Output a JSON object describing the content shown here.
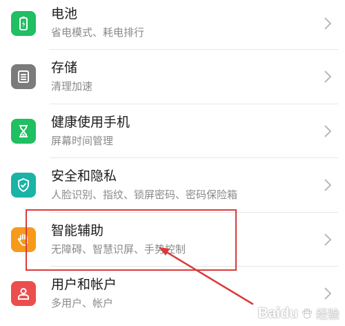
{
  "settings": {
    "items": [
      {
        "title": "电池",
        "subtitle": "省电模式、耗电排行",
        "icon": "battery-icon",
        "color": "#1fbf62"
      },
      {
        "title": "存储",
        "subtitle": "清理加速",
        "icon": "storage-icon",
        "color": "#7b7b7b"
      },
      {
        "title": "健康使用手机",
        "subtitle": "屏幕时间管理",
        "icon": "hourglass-icon",
        "color": "#1fbf62"
      },
      {
        "title": "安全和隐私",
        "subtitle": "人脸识别、指纹、锁屏密码、密码保险箱",
        "icon": "shield-icon",
        "color": "#19b3a7"
      },
      {
        "title": "智能辅助",
        "subtitle": "无障碍、智慧识屏、手势控制",
        "icon": "hand-icon",
        "color": "#f59a1c"
      },
      {
        "title": "用户和帐户",
        "subtitle": "多用户、帐户",
        "icon": "user-icon",
        "color": "#ec4d4d"
      }
    ]
  },
  "annotation": {
    "highlight_color": "#d93a3a",
    "watermark": "Baidu",
    "watermark_sub": "经验"
  }
}
